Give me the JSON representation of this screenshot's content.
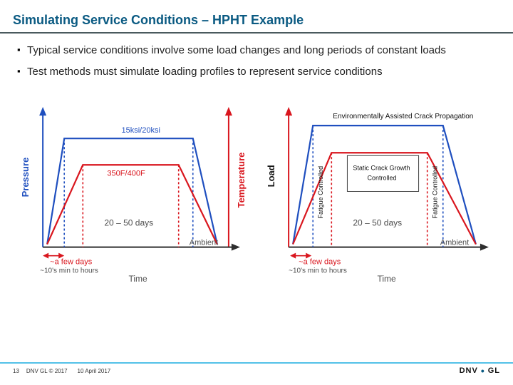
{
  "title": "Simulating Service Conditions – HPHT Example",
  "bullets": [
    "Typical service conditions involve some load changes and long periods of constant loads",
    "Test methods must simulate loading profiles to represent service conditions"
  ],
  "chart_data": [
    {
      "type": "line",
      "title": "",
      "xlabel": "Time",
      "ylabel_left": "Pressure",
      "ylabel_right": "Temperature",
      "x_phases": [
        {
          "label": "~a few days",
          "sub": "~10's min to hours",
          "color": "#d9161e"
        },
        {
          "label": "20 – 50 days",
          "sub": "",
          "color": "#4f4f4f"
        },
        {
          "label": "Ambient",
          "sub": "",
          "color": "#4f4f4f"
        }
      ],
      "series": [
        {
          "name": "Pressure",
          "color": "#1f4fbf",
          "label": "15ksi/20ksi",
          "profile": [
            [
              0,
              0
            ],
            [
              6,
              90
            ],
            [
              78,
              90
            ],
            [
              90,
              0
            ]
          ]
        },
        {
          "name": "Temperature",
          "color": "#d9161e",
          "label": "350F/400F",
          "profile": [
            [
              0,
              0
            ],
            [
              12,
              70
            ],
            [
              72,
              70
            ],
            [
              90,
              0
            ]
          ]
        }
      ]
    },
    {
      "type": "line",
      "title": "",
      "xlabel": "Time",
      "ylabel_left": "Load",
      "ylabel_right": "",
      "x_phases": [
        {
          "label": "~a few days",
          "sub": "~10's min to hours",
          "color": "#d9161e"
        },
        {
          "label": "20 – 50 days",
          "sub": "",
          "color": "#4f4f4f"
        },
        {
          "label": "Ambient",
          "sub": "",
          "color": "#4f4f4f"
        }
      ],
      "annotations": [
        {
          "text": "Environmentally Assisted Crack Propagation",
          "pos": "top"
        },
        {
          "text": "Fatigue Controlled",
          "pos": "left-inner",
          "rotated": true
        },
        {
          "text": "Static Crack Growth Controlled",
          "pos": "mid-box"
        },
        {
          "text": "Fatigue Controlled",
          "pos": "right-inner",
          "rotated": true
        }
      ],
      "series": [
        {
          "name": "Load-outer",
          "color": "#1f4fbf",
          "profile": [
            [
              0,
              0
            ],
            [
              8,
              92
            ],
            [
              78,
              92
            ],
            [
              92,
              0
            ]
          ]
        },
        {
          "name": "Load-inner",
          "color": "#d9161e",
          "profile": [
            [
              0,
              0
            ],
            [
              14,
              74
            ],
            [
              72,
              74
            ],
            [
              92,
              0
            ]
          ]
        }
      ]
    }
  ],
  "footer": {
    "page_no": "13",
    "copyright": "DNV GL © 2017",
    "date": "10 April 2017",
    "brand_a": "DNV",
    "brand_b": "GL"
  },
  "colors": {
    "heading": "#0a5a82",
    "line_blue": "#1f4fbf",
    "line_red": "#d9161e",
    "axis": "#2e2e2e",
    "accent": "#53c1e8"
  }
}
